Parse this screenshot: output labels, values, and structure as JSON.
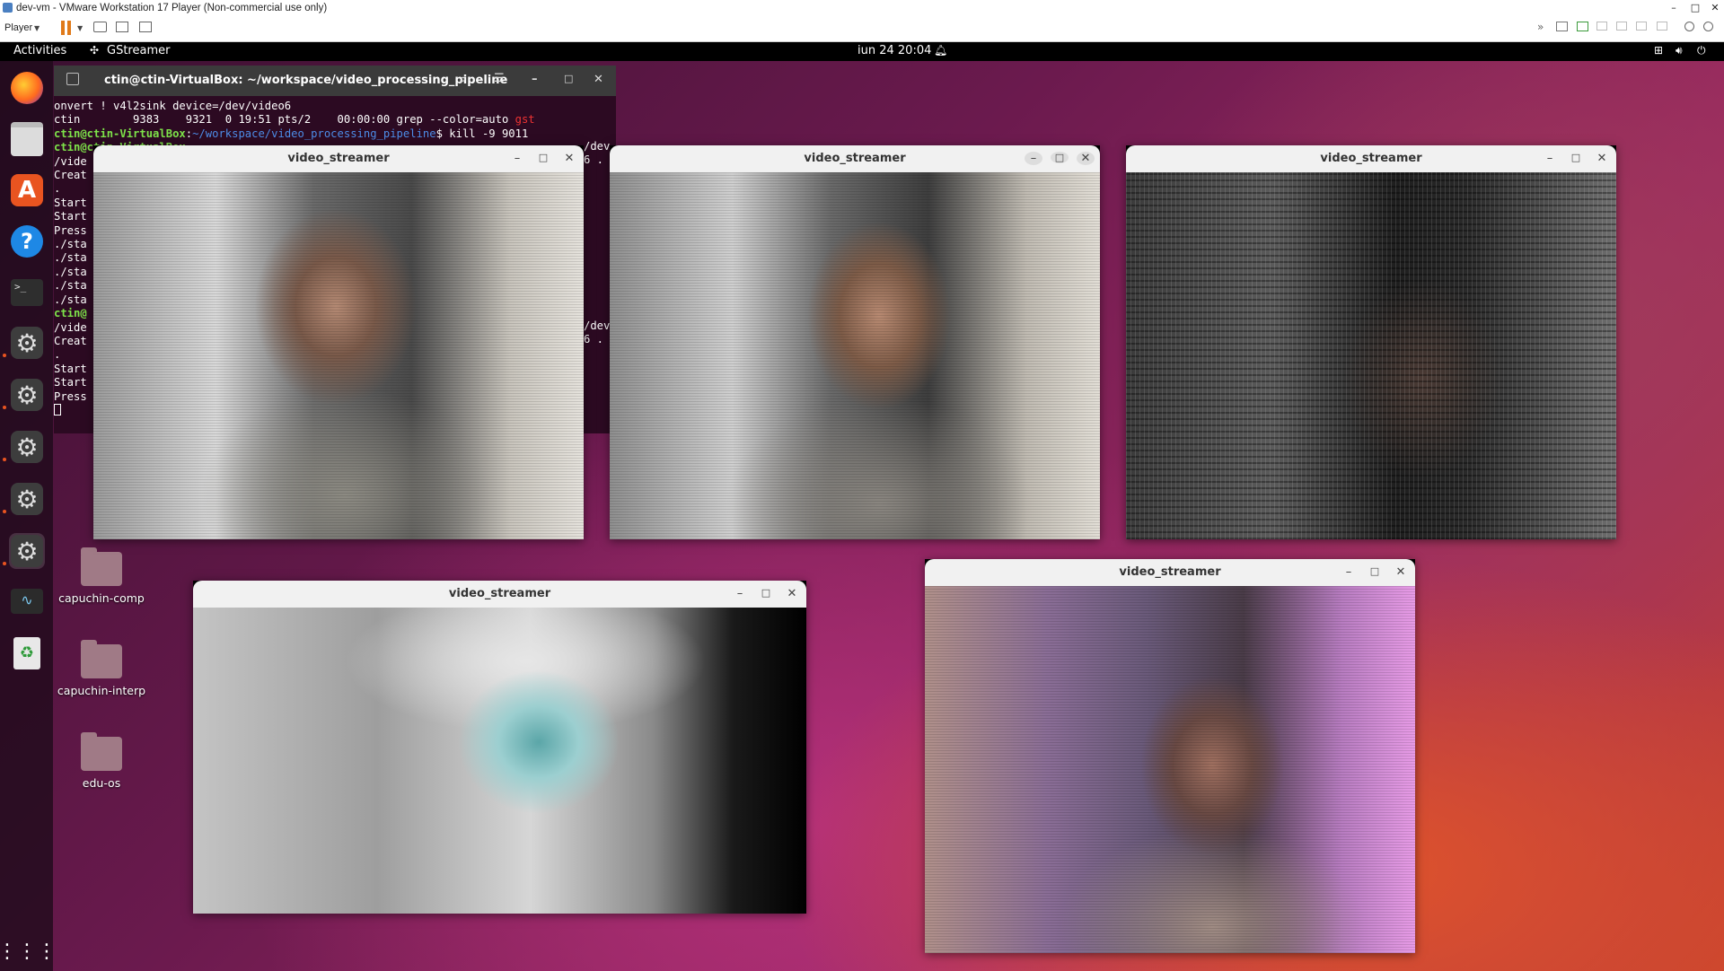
{
  "vmware": {
    "title": "dev-vm - VMware Workstation 17 Player (Non-commercial use only)",
    "player_menu": "Player"
  },
  "topbar": {
    "activities": "Activities",
    "app": "GStreamer",
    "clock": "iun 24  20:04"
  },
  "terminal": {
    "title": "ctin@ctin-VirtualBox: ~/workspace/video_processing_pipeline",
    "lines": [
      "onvert ! v4l2sink device=/dev/video6",
      "ctin        9383    9321  0 19:51 pts/2    00:00:00 grep --color=auto ",
      "ctin@ctin-VirtualBox",
      "/vide",
      "Creat",
      ".",
      "Start",
      "Start",
      "Press",
      "",
      "./sta",
      "./sta",
      "./sta",
      "./sta",
      "./sta",
      "ctin@",
      "/vide",
      "Creat",
      ".",
      "Start",
      "Start",
      "Press"
    ],
    "grep_word": "gst",
    "prompt_user": "ctin@ctin-VirtualBox",
    "prompt_path": "~/workspace/video_processing_pipeline",
    "prompt_cmd": "$ kill -9 9011",
    "right_overflow": [
      "/dev",
      "6 .",
      "/dev",
      "6 ."
    ]
  },
  "windows": [
    {
      "title": "video_streamer",
      "effect": "vertigo"
    },
    {
      "title": "video_streamer",
      "effect": "chromatic"
    },
    {
      "title": "video_streamer",
      "effect": "ascii"
    },
    {
      "title": "video_streamer",
      "effect": "inverted-flipped"
    },
    {
      "title": "video_streamer",
      "effect": "color-shift"
    }
  ],
  "folders": [
    {
      "label": "capuchin-comp"
    },
    {
      "label": "capuchin-interp"
    },
    {
      "label": "edu-os"
    }
  ],
  "window_controls": {
    "minimize": "–",
    "maximize": "□",
    "close": "✕"
  },
  "icons": {
    "firefox": "firefox-icon",
    "files": "files-icon",
    "appstore": "ubuntu-software-icon",
    "help": "help-icon",
    "terminal": "terminal-icon",
    "settings": "settings-icon",
    "monitor": "system-monitor-icon",
    "trash": "trash-icon",
    "grid": "app-grid-icon"
  }
}
